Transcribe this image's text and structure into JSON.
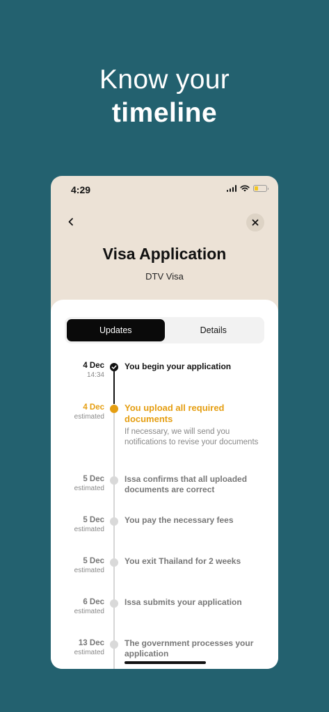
{
  "headline": {
    "line1": "Know your",
    "line2": "timeline"
  },
  "status_bar": {
    "time": "4:29",
    "battery_level": 0.3
  },
  "header": {
    "title": "Visa Application",
    "subtitle": "DTV Visa"
  },
  "tabs": [
    {
      "label": "Updates",
      "active": true
    },
    {
      "label": "Details",
      "active": false
    }
  ],
  "timeline": [
    {
      "date": "4 Dec",
      "sub": "14:34",
      "label": "You begin your application",
      "state": "done"
    },
    {
      "date": "4 Dec",
      "sub": "estimated",
      "label": "You upload all required documents",
      "description": "If necessary, we will send you notifications to revise your documents",
      "state": "current"
    },
    {
      "date": "5 Dec",
      "sub": "estimated",
      "label": "Issa confirms that all uploaded documents are correct",
      "state": "pending"
    },
    {
      "date": "5 Dec",
      "sub": "estimated",
      "label": "You pay the necessary fees",
      "state": "pending"
    },
    {
      "date": "5 Dec",
      "sub": "estimated",
      "label": "You exit Thailand for 2 weeks",
      "state": "pending"
    },
    {
      "date": "6 Dec",
      "sub": "estimated",
      "label": "Issa submits your application",
      "state": "pending"
    },
    {
      "date": "13 Dec",
      "sub": "estimated",
      "label": "The government processes your application",
      "state": "pending"
    }
  ],
  "colors": {
    "background": "#23616f",
    "card": "#ece2d6",
    "accent": "#e59e11",
    "done": "#111111"
  },
  "icons": {
    "back": "chevron-left-icon",
    "close": "close-icon",
    "check": "checkmark-icon"
  }
}
